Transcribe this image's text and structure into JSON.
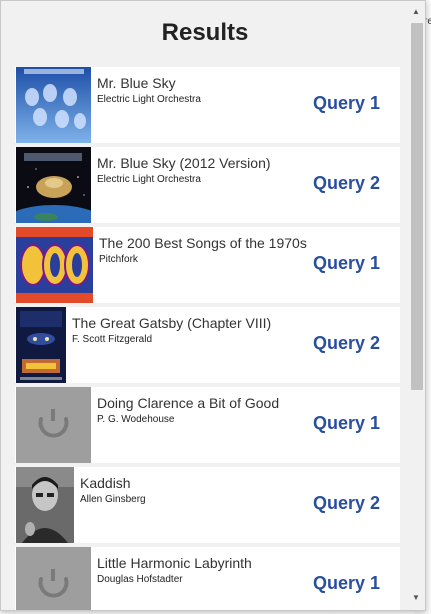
{
  "background": {
    "peek_text": "re"
  },
  "popup": {
    "title": "Results",
    "items": [
      {
        "title": "Mr. Blue Sky",
        "subtitle": "Electric Light Orchestra",
        "query": "Query 1",
        "thumb": "elo-album-cover"
      },
      {
        "title": "Mr. Blue Sky (2012 Version)",
        "subtitle": "Electric Light Orchestra",
        "query": "Query 2",
        "thumb": "elo-spaceship-cover"
      },
      {
        "title": "The 200 Best Songs of the 1970s",
        "subtitle": "Pitchfork",
        "query": "Query 1",
        "thumb": "pitchfork-200-cover"
      },
      {
        "title": "The Great Gatsby (Chapter VIII)",
        "subtitle": "F. Scott Fitzgerald",
        "query": "Query 2",
        "thumb": "gatsby-book-cover"
      },
      {
        "title": "Doing Clarence a Bit of Good",
        "subtitle": "P. G. Wodehouse",
        "query": "Query 1",
        "thumb": "placeholder-cover"
      },
      {
        "title": "Kaddish",
        "subtitle": "Allen Ginsberg",
        "query": "Query 2",
        "thumb": "author-portrait"
      },
      {
        "title": "Little Harmonic Labyrinth",
        "subtitle": "Douglas Hofstadter",
        "query": "Query 1",
        "thumb": "placeholder-cover"
      }
    ]
  },
  "colors": {
    "query_link": "#2a4fa0",
    "placeholder": "#9e9e9e"
  }
}
